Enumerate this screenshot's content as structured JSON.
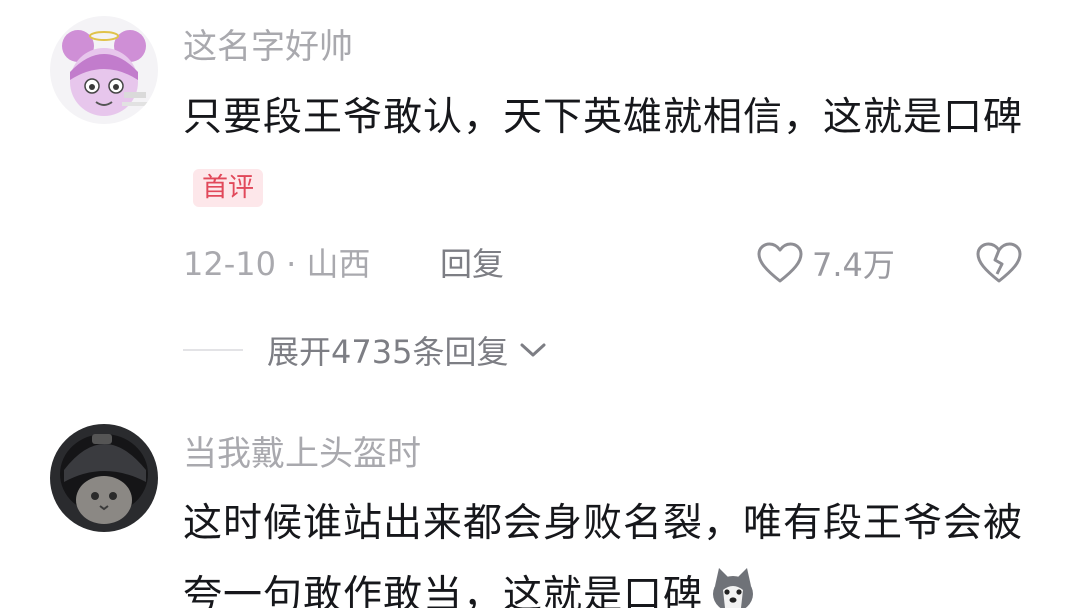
{
  "comments": [
    {
      "username": "这名字好帅",
      "text": "只要段王爷敢认，天下英雄就相信，这就是口碑",
      "badge": "首评",
      "meta": "12-10 · 山西",
      "reply_label": "回复",
      "likes": "7.4万",
      "expand_label": "展开4735条回复"
    },
    {
      "username": "当我戴上头盔时",
      "text": "这时候谁站出来都会身败名裂，唯有段王爷会被夸一句敢作敢当，这就是口碑"
    }
  ],
  "icons": {
    "like": "heart-icon",
    "dislike": "broken-heart-icon",
    "expand": "chevron-down-icon",
    "emoji": "husky-dog-emoji-icon"
  },
  "colors": {
    "text": "#16171b",
    "muted": "#a9a9ae",
    "badge_text": "#e1485a",
    "badge_bg": "#fde7ea"
  }
}
